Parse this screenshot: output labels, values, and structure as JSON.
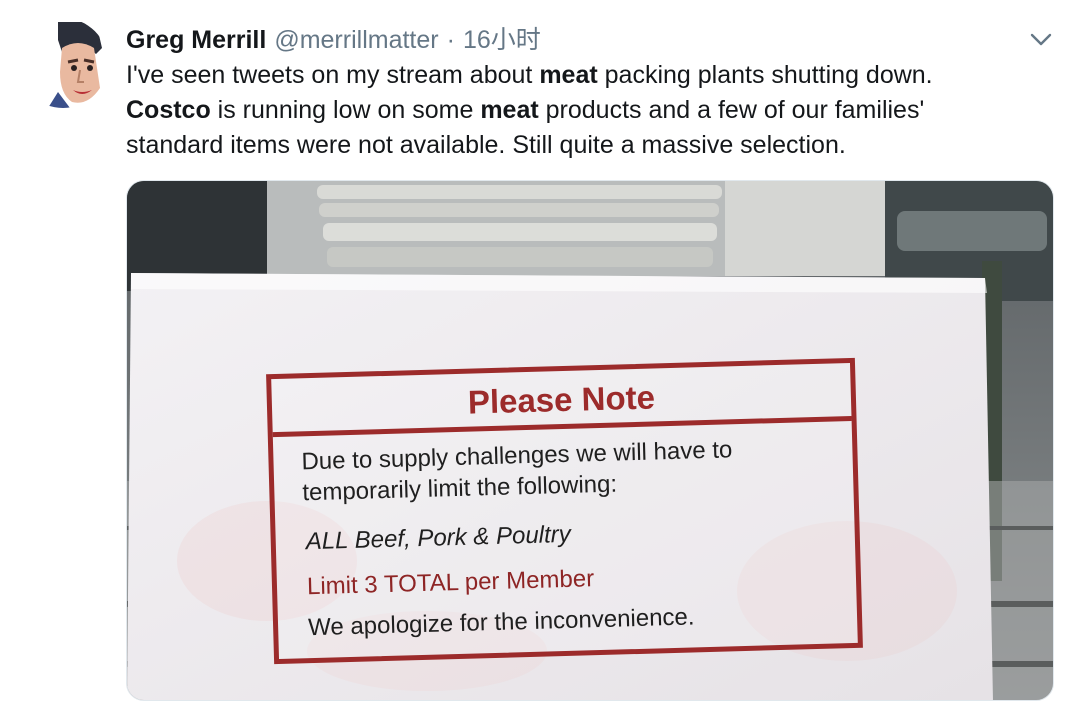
{
  "author": {
    "name": "Greg Merrill",
    "handle": "@merrillmatter",
    "separator": "·",
    "time": "16小时"
  },
  "icons": {
    "avatar": "user-avatar",
    "menu": "chevron-down-icon"
  },
  "tweet": {
    "line1_pre": "I've seen tweets on my stream about ",
    "line1_bold": "meat",
    "line1_post": " packing plants shutting down.",
    "line2_bold1": "Costco",
    "line2_mid": " is running low on some ",
    "line2_bold2": "meat",
    "line2_post": " products and a few of our families'",
    "line3": "standard items were not available.  Still quite a massive selection."
  },
  "sign": {
    "title": "Please Note",
    "line1": "Due to supply challenges we will have to",
    "line2": "temporarily limit the following:",
    "line3": "ALL Beef, Pork & Poultry",
    "line4": "Limit 3 TOTAL per Member",
    "line5": "We apologize for the inconvenience."
  },
  "colors": {
    "name": "#14171a",
    "secondary": "#657786",
    "sign_red": "#9c2b2b"
  }
}
